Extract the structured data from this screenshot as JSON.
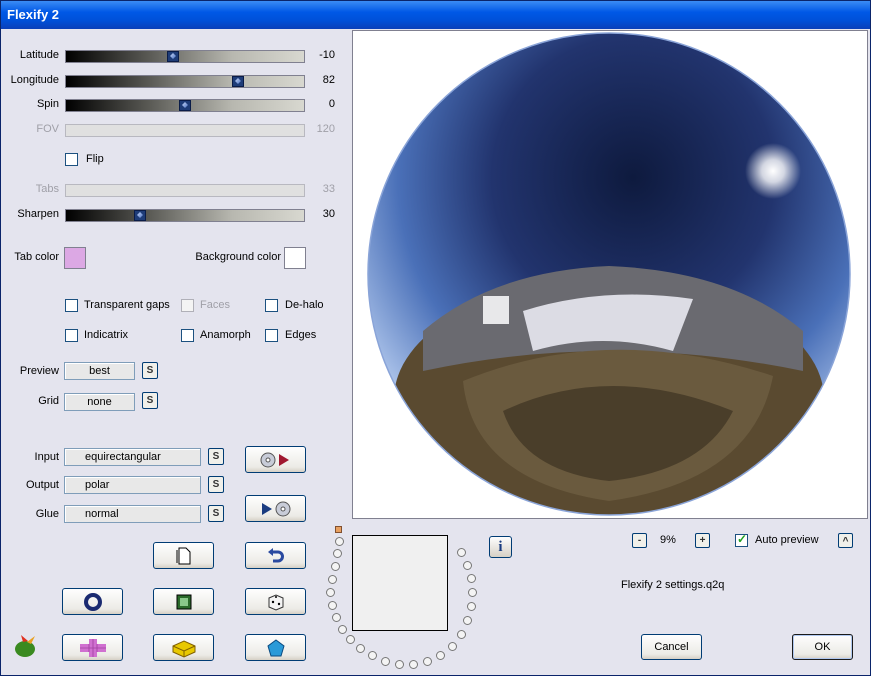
{
  "window": {
    "title": "Flexify 2"
  },
  "sliders": {
    "latitude": {
      "label": "Latitude",
      "value": "-10",
      "position": 0.45
    },
    "longitude": {
      "label": "Longitude",
      "value": "82",
      "position": 0.72
    },
    "spin": {
      "label": "Spin",
      "value": "0",
      "position": 0.5
    },
    "fov": {
      "label": "FOV",
      "value": "120",
      "disabled": true
    },
    "tabs": {
      "label": "Tabs",
      "value": "33",
      "disabled": true
    },
    "sharpen": {
      "label": "Sharpen",
      "value": "30",
      "position": 0.3
    }
  },
  "flip": {
    "label": "Flip",
    "checked": false
  },
  "colors": {
    "tab_color_label": "Tab color",
    "tab_color": "#dca8e4",
    "background_color_label": "Background color",
    "background_color": "#ffffff"
  },
  "options": {
    "transparent_gaps": "Transparent gaps",
    "faces": "Faces",
    "de_halo": "De-halo",
    "indicatrix": "Indicatrix",
    "anamorph": "Anamorph",
    "edges": "Edges"
  },
  "selects": {
    "preview_label": "Preview",
    "preview_value": "best",
    "grid_label": "Grid",
    "grid_value": "none",
    "input_label": "Input",
    "input_value": "equirectangular",
    "output_label": "Output",
    "output_value": "polar",
    "glue_label": "Glue",
    "glue_value": "normal",
    "s_button": "S"
  },
  "zoom": {
    "minus": "-",
    "value": "9%",
    "plus": "+"
  },
  "auto_preview": {
    "label": "Auto preview",
    "checked": true,
    "toggle": "^"
  },
  "settings_file": "Flexify 2 settings.q2q",
  "info_button": "i",
  "buttons": {
    "cancel": "Cancel",
    "ok": "OK"
  }
}
